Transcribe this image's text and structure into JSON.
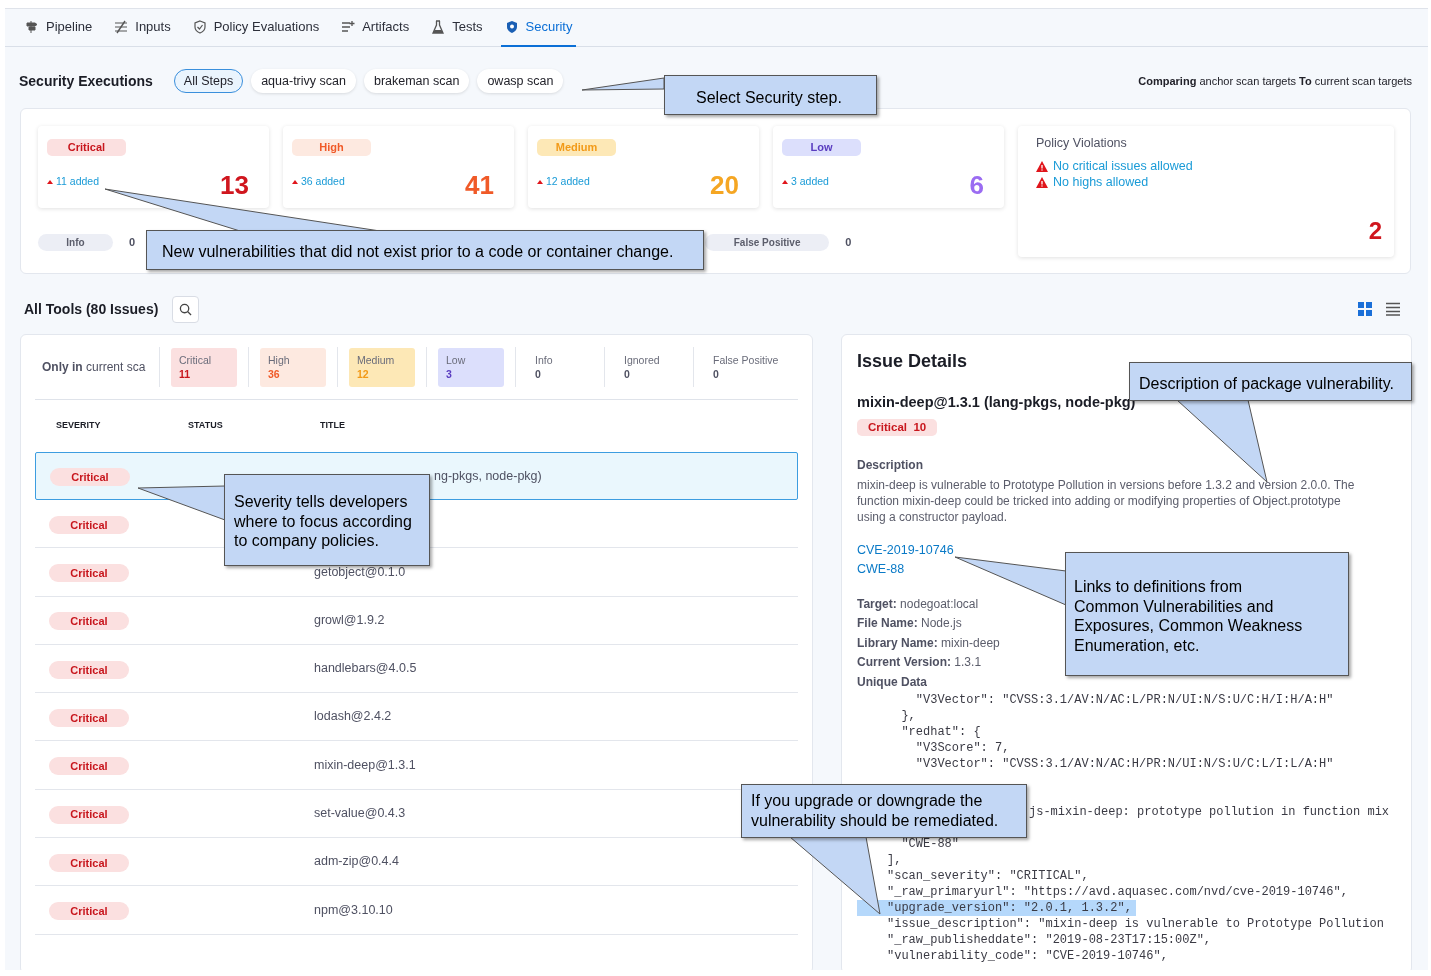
{
  "tabs": [
    {
      "label": "Pipeline",
      "selected": false
    },
    {
      "label": "Inputs",
      "selected": false
    },
    {
      "label": "Policy Evaluations",
      "selected": false
    },
    {
      "label": "Artifacts",
      "selected": false
    },
    {
      "label": "Tests",
      "selected": false
    },
    {
      "label": "Security",
      "selected": true
    }
  ],
  "executions": {
    "title": "Security Executions",
    "steps": [
      {
        "label": "All Steps",
        "selected": true
      },
      {
        "label": "aqua-trivy scan",
        "selected": false
      },
      {
        "label": "brakeman scan",
        "selected": false
      },
      {
        "label": "owasp scan",
        "selected": false
      }
    ],
    "comparison": "**Comparing** anchor scan targets  **To** current scan targets"
  },
  "summary": {
    "severities": [
      {
        "kind": "critical",
        "label": "Critical",
        "added": "11 added",
        "count": "13"
      },
      {
        "kind": "high",
        "label": "High",
        "added": "36 added",
        "count": "41"
      },
      {
        "kind": "medium",
        "label": "Medium",
        "added": "12 added",
        "count": "20"
      },
      {
        "kind": "low",
        "label": "Low",
        "added": "3 added",
        "count": "6"
      }
    ],
    "extras": [
      {
        "label": "Info",
        "count": "0"
      },
      {
        "label": "False Positive",
        "count": "0"
      }
    ],
    "policy": {
      "title": "Policy Violations",
      "items": [
        "No critical issues allowed",
        "No highs allowed"
      ],
      "count": "2"
    }
  },
  "tools": {
    "title": "All Tools (80 Issues)",
    "view_modes": [
      {
        "kind": "grid",
        "selected": true
      },
      {
        "kind": "list",
        "selected": false
      }
    ]
  },
  "issues": {
    "filter_label": "**Only in** current sca",
    "filters": [
      {
        "kind": "critical",
        "label": "Critical",
        "count": "11"
      },
      {
        "kind": "high",
        "label": "High",
        "count": "36"
      },
      {
        "kind": "medium",
        "label": "Medium",
        "count": "12"
      },
      {
        "kind": "low",
        "label": "Low",
        "count": "3"
      },
      {
        "kind": "plain",
        "label": "Info",
        "count": "0"
      },
      {
        "kind": "plain",
        "label": "Ignored",
        "count": "0"
      },
      {
        "kind": "plain",
        "label": "False Positive",
        "count": "0"
      }
    ],
    "columns": [
      "SEVERITY",
      "STATUS",
      "TITLE"
    ],
    "rows": [
      {
        "severity": "Critical",
        "kind": "partial",
        "title": "ng-pkgs, node-pkg)",
        "selected": true
      },
      {
        "severity": "Critical",
        "selected": false
      },
      {
        "severity": "Critical",
        "kind": "full",
        "title": "getobject@0.1.0",
        "selected": false
      },
      {
        "severity": "Critical",
        "kind": "full",
        "title": "growl@1.9.2",
        "selected": false
      },
      {
        "severity": "Critical",
        "kind": "full",
        "title": "handlebars@4.0.5",
        "selected": false
      },
      {
        "severity": "Critical",
        "kind": "full",
        "title": "lodash@2.4.2",
        "selected": false
      },
      {
        "severity": "Critical",
        "kind": "full",
        "title": "mixin-deep@1.3.1",
        "selected": false
      },
      {
        "severity": "Critical",
        "kind": "full",
        "title": "set-value@0.4.3",
        "selected": false
      },
      {
        "severity": "Critical",
        "kind": "full",
        "title": "adm-zip@0.4.4",
        "selected": false
      },
      {
        "severity": "Critical",
        "kind": "full",
        "title": "npm@3.10.10",
        "selected": false
      }
    ]
  },
  "details": {
    "title": "Issue Details",
    "package": "mixin-deep@1.3.1 (lang-pkgs, node-pkg)",
    "badge": "Critical  10",
    "description_label": "Description",
    "description": "mixin-deep is vulnerable to Prototype Pollution in versions before 1.3.2 and version 2.0.0. The function mixin-deep could be tricked into adding or modifying properties of Object.prototype using a constructor payload.",
    "links": [
      "CVE-2019-10746",
      "CWE-88"
    ],
    "fields": [
      {
        "label": "Target:",
        "value": "nodegoat:local"
      },
      {
        "label": "File Name:",
        "value": "Node.js"
      },
      {
        "label": "Library Name:",
        "value": "mixin-deep"
      },
      {
        "label": "Current Version:",
        "value": "1.3.1"
      }
    ],
    "unique_data_label": "Unique Data",
    "code_lines": [
      {
        "kind": "line",
        "text": "    \"V3Vector\": \"CVSS:3.1/AV:N/AC:L/PR:N/UI:N/S:U/C:H/I:H/A:H\""
      },
      {
        "kind": "line",
        "text": "  },"
      },
      {
        "kind": "line",
        "text": "  \"redhat\": {"
      },
      {
        "kind": "line",
        "text": "    \"V3Score\": 7,"
      },
      {
        "kind": "line",
        "text": "    \"V3Vector\": \"CVSS:3.1/AV:N/AC:H/PR:N/UI:N/S:U/C:L/I:L/A:H\""
      },
      {
        "kind": "tail",
        "text": "js-mixin-deep: prototype pollution in function mix"
      },
      {
        "kind": "line",
        "text": "  \"CWE-88\""
      },
      {
        "kind": "line",
        "text": "],"
      },
      {
        "kind": "line",
        "text": "\"scan_severity\": \"CRITICAL\","
      },
      {
        "kind": "line",
        "text": "\"_raw_primaryurl\": \"https://avd.aquasec.com/nvd/cve-2019-10746\","
      },
      {
        "kind": "highlight",
        "text": "\"upgrade_version\": \"2.0.1, 1.3.2\","
      },
      {
        "kind": "line",
        "text": "\"issue_description\": \"mixin-deep is vulnerable to Prototype Pollution"
      },
      {
        "kind": "line",
        "text": "\"_raw_publisheddate\": \"2019-08-23T17:15:00Z\","
      },
      {
        "kind": "line",
        "text": "\"vulnerability_code\": \"CVE-2019-10746\","
      }
    ]
  },
  "callouts": [
    {
      "text": "Select Security step."
    },
    {
      "text": "New vulnerabilities that did not exist prior to a code or container change."
    },
    {
      "text": "Severity tells developers where to focus according to company policies."
    },
    {
      "text": "Description of package vulnerability."
    },
    {
      "text": "Links to definitions from Common Vulnerabilities and Exposures, Common Weakness Enumeration, etc."
    },
    {
      "text": "If you upgrade or downgrade the vulnerability should be remediated."
    }
  ]
}
